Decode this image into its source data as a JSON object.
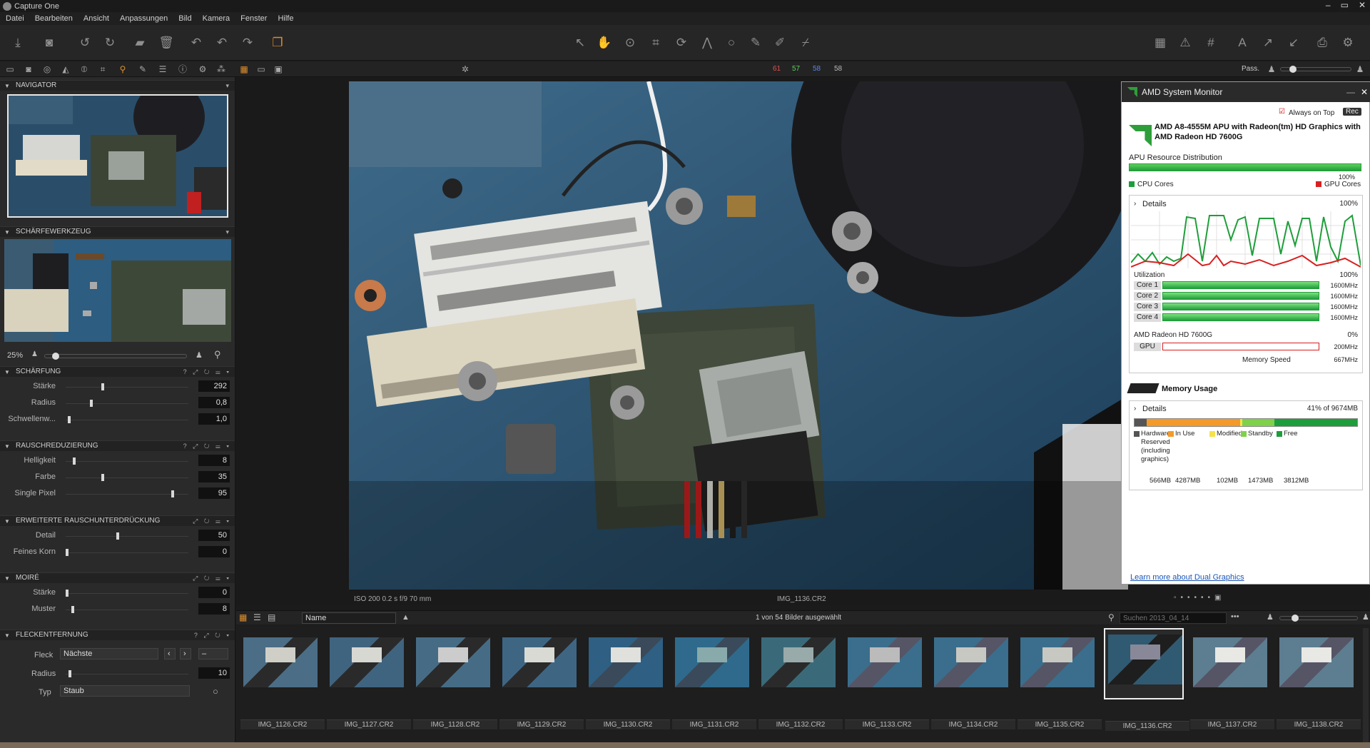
{
  "window": {
    "title": "Capture One"
  },
  "menu": [
    "Datei",
    "Bearbeiten",
    "Ansicht",
    "Anpassungen",
    "Bild",
    "Kamera",
    "Fenster",
    "Hilfe"
  ],
  "toolrow": {
    "nums": [
      "61",
      "57",
      "58",
      "58"
    ],
    "pass": "Pass."
  },
  "panels": {
    "navigator": "NAVIGATOR",
    "focus": "SCHÄRFEWERKZEUG",
    "focus_zoom": "25%",
    "sharpening": {
      "title": "SCHÄRFUNG",
      "rows": [
        {
          "label": "Stärke",
          "value": "292",
          "pos": 0.3
        },
        {
          "label": "Radius",
          "value": "0,8",
          "pos": 0.2
        },
        {
          "label": "Schwellenw...",
          "value": "1,0",
          "pos": 0.02
        }
      ]
    },
    "noise": {
      "title": "RAUSCHREDUZIERUNG",
      "rows": [
        {
          "label": "Helligkeit",
          "value": "8",
          "pos": 0.06
        },
        {
          "label": "Farbe",
          "value": "35",
          "pos": 0.3
        },
        {
          "label": "Single Pixel",
          "value": "95",
          "pos": 0.88
        }
      ]
    },
    "advnoise": {
      "title": "ERWEITERTE RAUSCHUNTERDRÜCKUNG",
      "rows": [
        {
          "label": "Detail",
          "value": "50",
          "pos": 0.42
        },
        {
          "label": "Feines Korn",
          "value": "0",
          "pos": 0.0
        }
      ]
    },
    "moire": {
      "title": "MOIRÉ",
      "rows": [
        {
          "label": "Stärke",
          "value": "0",
          "pos": 0.0
        },
        {
          "label": "Muster",
          "value": "8",
          "pos": 0.05
        }
      ]
    },
    "spot": {
      "title": "FLECKENTFERNUNG",
      "fleck_label": "Fleck",
      "fleck_value": "Nächste",
      "radius_label": "Radius",
      "radius_value": "10",
      "typ_label": "Typ",
      "typ_value": "Staub"
    }
  },
  "viewer": {
    "exif": "ISO 200  0.2 s  f/9  70 mm",
    "filename": "IMG_1136.CR2"
  },
  "browser": {
    "sort": "Name",
    "count": "1 von 54 Bilder ausgewählt",
    "search_placeholder": "Suchen 2013_04_14"
  },
  "thumbs": [
    "IMG_1126.CR2",
    "IMG_1127.CR2",
    "IMG_1128.CR2",
    "IMG_1129.CR2",
    "IMG_1130.CR2",
    "IMG_1131.CR2",
    "IMG_1132.CR2",
    "IMG_1133.CR2",
    "IMG_1134.CR2",
    "IMG_1135.CR2",
    "IMG_1136.CR2",
    "IMG_1137.CR2",
    "IMG_1138.CR2"
  ],
  "amd": {
    "title": "AMD System Monitor",
    "always_on_top": "Always on Top",
    "rec": "Rec",
    "apu_name": "AMD A8-4555M APU with Radeon(tm) HD Graphics   with AMD Radeon HD 7600G",
    "apu_resource": "APU Resource Distribution",
    "apu_pct": "100%",
    "cpu_cores": "CPU Cores",
    "gpu_cores": "GPU Cores",
    "details": "Details",
    "details_pct": "100%",
    "utilization": "Utilization",
    "util_pct": "100%",
    "cores": [
      {
        "name": "Core 1",
        "mhz": "1600MHz",
        "fill": 1.0
      },
      {
        "name": "Core 2",
        "mhz": "1600MHz",
        "fill": 1.0
      },
      {
        "name": "Core 3",
        "mhz": "1600MHz",
        "fill": 1.0
      },
      {
        "name": "Core 4",
        "mhz": "1600MHz",
        "fill": 1.0
      }
    ],
    "gpu_title": "AMD Radeon HD 7600G",
    "gpu_pct": "0%",
    "gpu_label": "GPU",
    "gpu_mhz": "200MHz",
    "mem_speed_label": "Memory Speed",
    "mem_speed": "667MHz",
    "memory_usage": "Memory Usage",
    "mem_details": "Details",
    "mem_summary": "41% of 9674MB",
    "mem_legend": [
      {
        "label": "Hardware Reserved (including graphics)",
        "value": "566MB",
        "color": "#555555"
      },
      {
        "label": "In Use",
        "value": "4287MB",
        "color": "#f39a2b"
      },
      {
        "label": "Modified",
        "value": "102MB",
        "color": "#f5e24a"
      },
      {
        "label": "Standby",
        "value": "1473MB",
        "color": "#7fd14a"
      },
      {
        "label": "Free",
        "value": "3812MB",
        "color": "#1e9e3a"
      }
    ],
    "link": "Learn more about Dual Graphics"
  },
  "colors": {
    "accent": "#e08a2e",
    "amd_green": "#2e9e3a",
    "gpu_red": "#d92020"
  }
}
